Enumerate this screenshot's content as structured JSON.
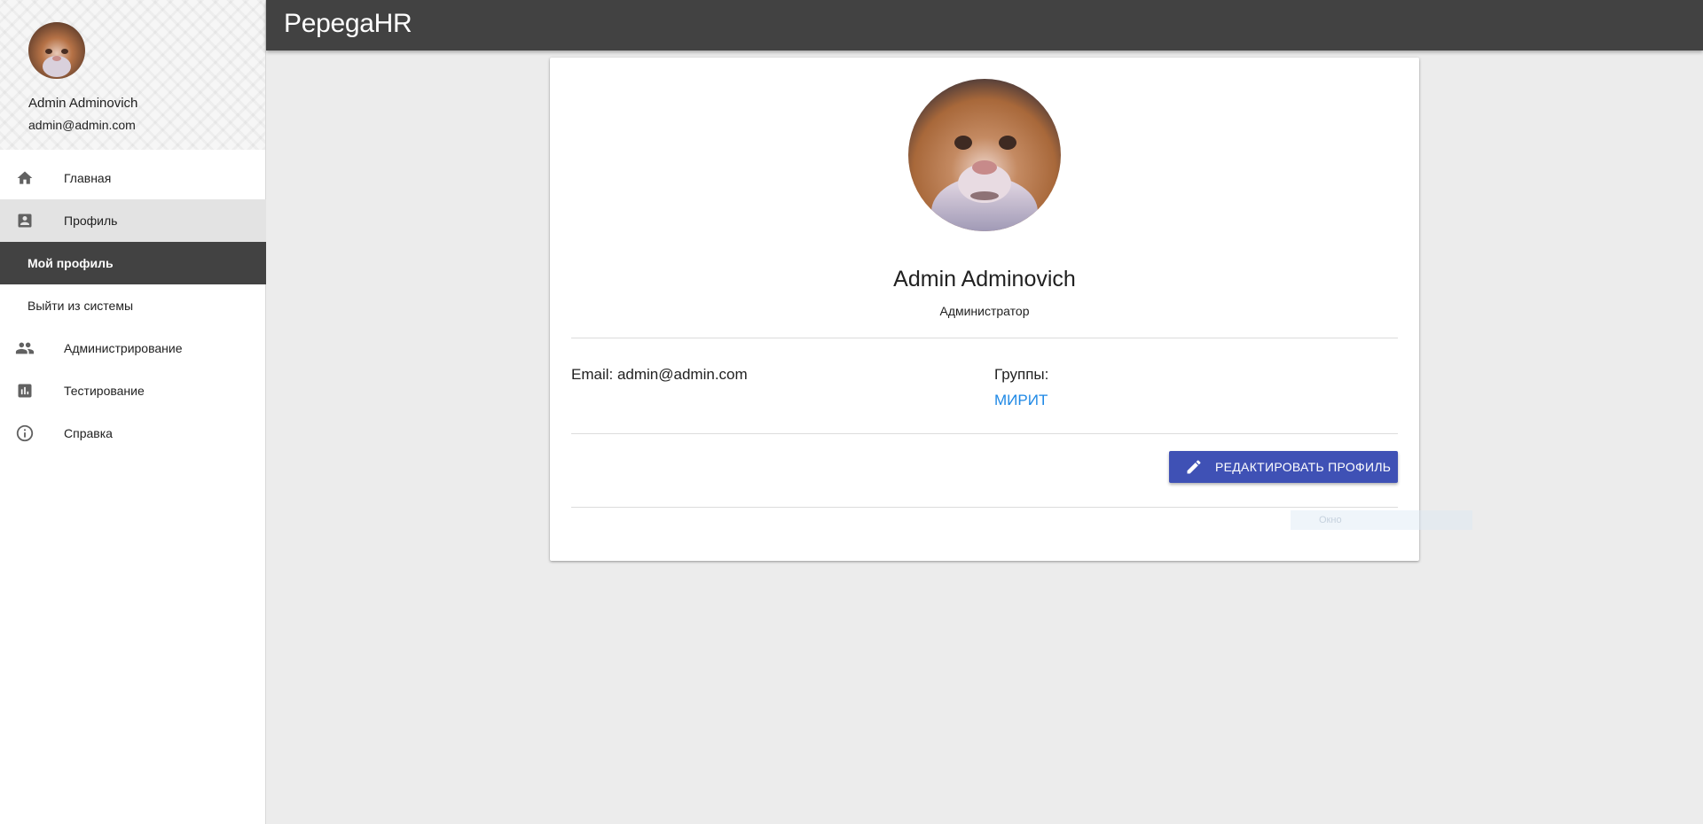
{
  "app": {
    "title": "PepegaHR"
  },
  "user": {
    "name": "Admin Adminovich",
    "email": "admin@admin.com",
    "avatar": "hamster-photo"
  },
  "sidebar": {
    "items": [
      {
        "label": "Главная",
        "icon": "home-icon"
      },
      {
        "label": "Профиль",
        "icon": "account-box-icon",
        "selected": true
      },
      {
        "label": "Мой профиль",
        "sub": true,
        "active": true
      },
      {
        "label": "Выйти из системы",
        "sub": true
      },
      {
        "label": "Администрирование",
        "icon": "people-icon"
      },
      {
        "label": "Тестирование",
        "icon": "bar-chart-icon"
      },
      {
        "label": "Справка",
        "icon": "info-icon"
      }
    ]
  },
  "profile": {
    "name": "Admin Adminovich",
    "role": "Администратор",
    "email_text": "Email: admin@admin.com",
    "groups_label": "Группы:",
    "groups": [
      "МИРИТ"
    ],
    "edit_button": "РЕДАКТИРОВАТЬ ПРОФИЛЬ"
  },
  "tooltip": {
    "text": "Окно"
  },
  "colors": {
    "appbar": "#424242",
    "accent_button": "#3f51b5",
    "link": "#1e88e5",
    "active_nav": "#424242"
  }
}
